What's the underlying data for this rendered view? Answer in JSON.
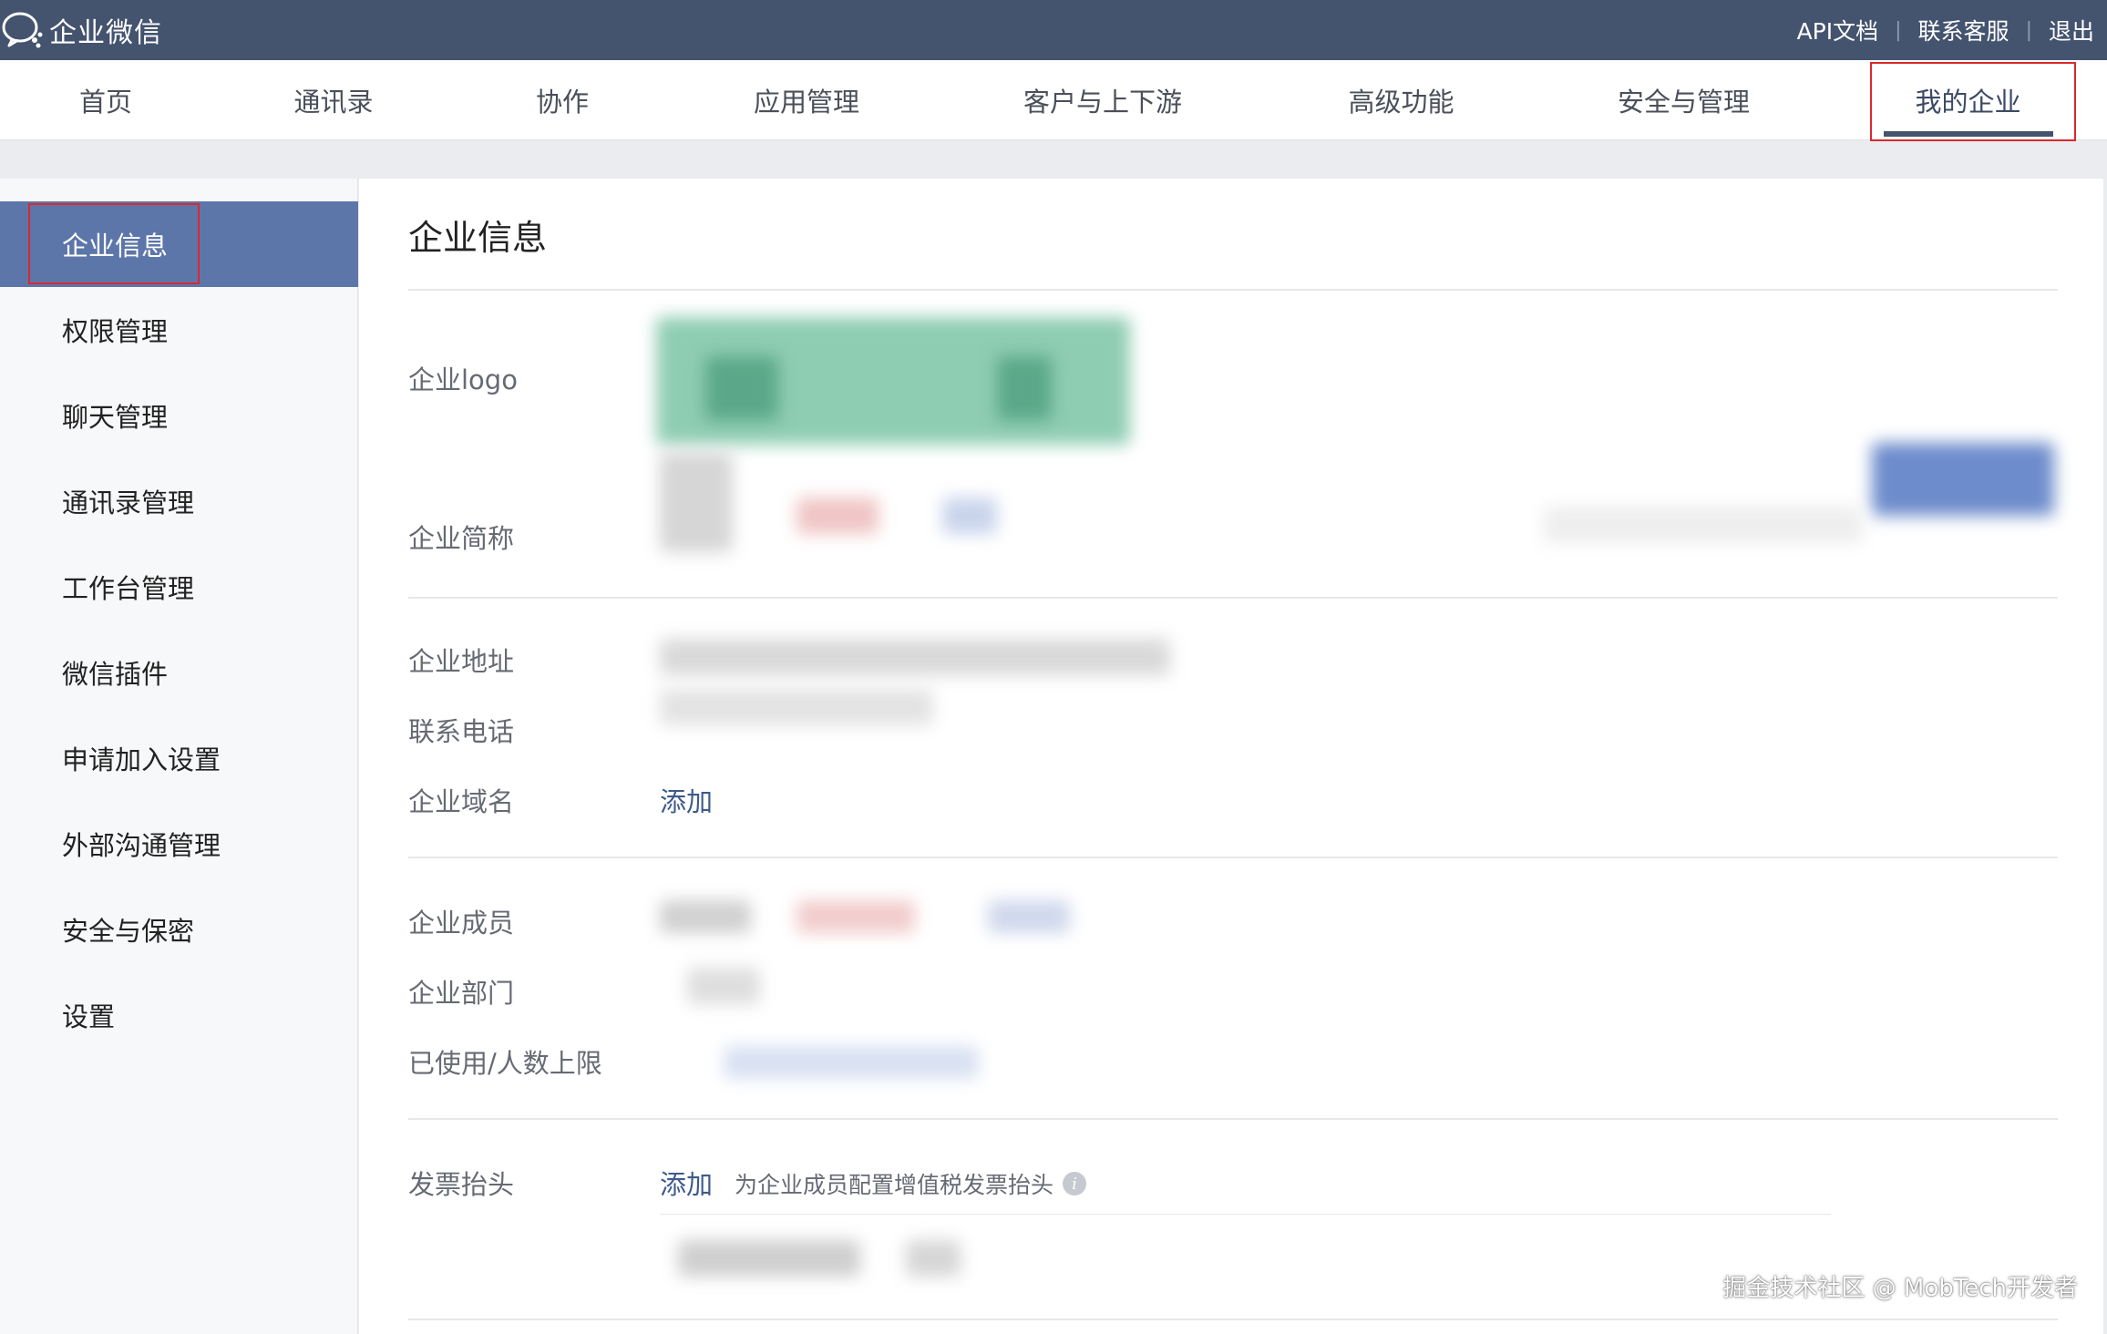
{
  "app": {
    "name": "企业微信"
  },
  "topbar": {
    "links": [
      "API文档",
      "联系客服",
      "退出"
    ],
    "separator": "|"
  },
  "nav": {
    "items": [
      "首页",
      "通讯录",
      "协作",
      "应用管理",
      "客户与上下游",
      "高级功能",
      "安全与管理",
      "我的企业"
    ],
    "active": "我的企业"
  },
  "sidebar": {
    "items": [
      "企业信息",
      "权限管理",
      "聊天管理",
      "通讯录管理",
      "工作台管理",
      "微信插件",
      "申请加入设置",
      "外部沟通管理",
      "安全与保密",
      "设置"
    ],
    "active": "企业信息"
  },
  "main": {
    "title": "企业信息",
    "fields": {
      "logo": "企业logo",
      "short_name": "企业简称",
      "address": "企业地址",
      "phone": "联系电话",
      "domain": "企业域名",
      "members": "企业成员",
      "departments": "企业部门",
      "usage_limit": "已使用/人数上限",
      "invoice": "发票抬头"
    },
    "domain_add": "添加",
    "invoice_add": "添加",
    "invoice_hint": "为企业成员配置增值税发票抬头",
    "info_icon_glyph": "i"
  },
  "watermark": "掘金技术社区 @ MobTech开发者",
  "colors": {
    "topbar": "#44536e",
    "sidebar_active": "#5d76aa",
    "link": "#3d5a8c",
    "highlight": "#d9282f"
  }
}
